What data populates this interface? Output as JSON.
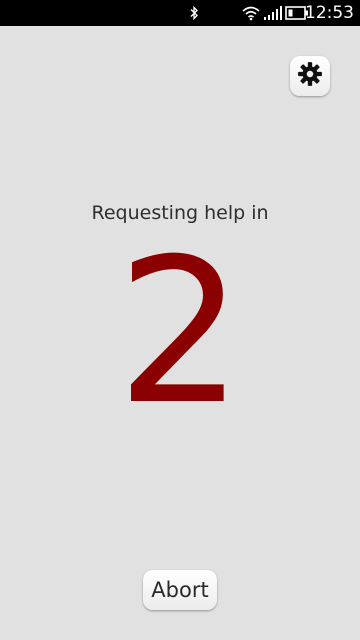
{
  "status_bar": {
    "time": "12:53",
    "icons": [
      "bluetooth-icon",
      "wifi-icon",
      "signal-icon",
      "battery-icon"
    ]
  },
  "settings": {
    "icon": "gear-icon"
  },
  "main": {
    "label": "Requesting help in",
    "countdown": "2",
    "countdown_color": "#8b0000"
  },
  "actions": {
    "abort_label": "Abort"
  },
  "colors": {
    "background": "#e1e1e1",
    "status_bar": "#000000"
  }
}
